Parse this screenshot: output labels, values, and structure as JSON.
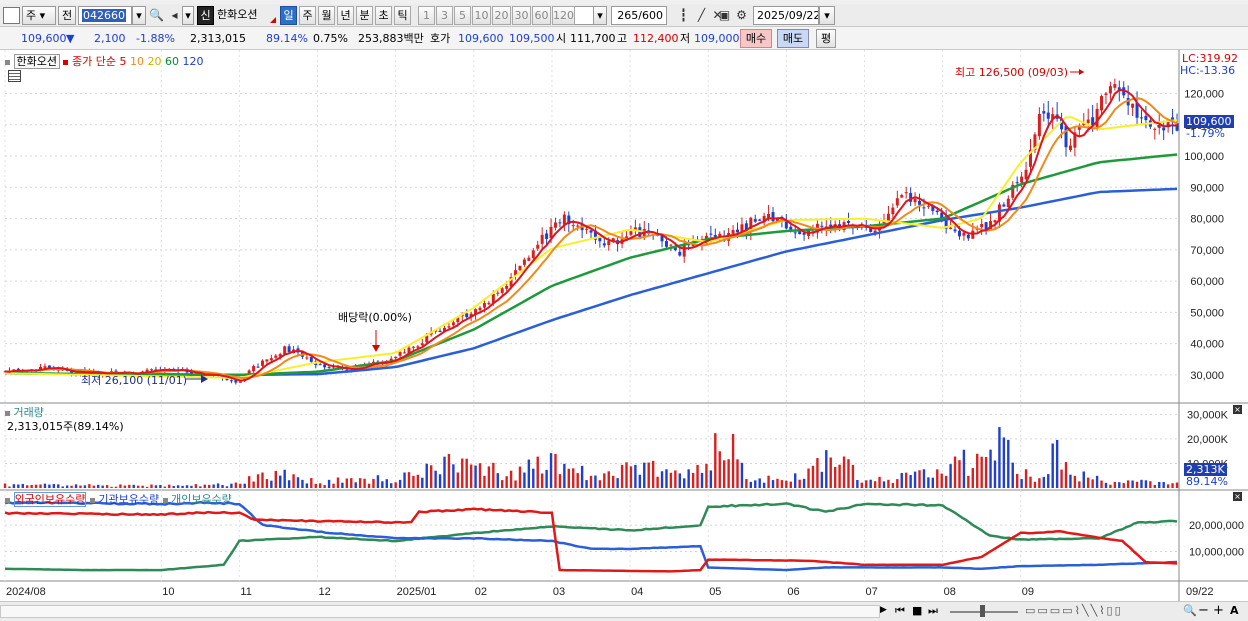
{
  "toolbar1": {
    "type_label": "주",
    "prev_label": "전",
    "code": "042660",
    "stock_badge": "신",
    "stock_name": "한화오션",
    "periods": [
      "일",
      "주",
      "월",
      "년",
      "분",
      "초",
      "틱"
    ],
    "active_period": "일",
    "intervals": [
      "1",
      "3",
      "5",
      "10",
      "20",
      "30",
      "60",
      "120"
    ],
    "count": "265",
    "count_total": "/600",
    "date": "2025/09/22"
  },
  "toolbar2": {
    "price": "109,600",
    "change_arrow": "▼",
    "change": "2,100",
    "change_pct": "-1.88%",
    "volume": "2,313,015",
    "vol_ratio": "89.14%",
    "turnover_pct": "0.75%",
    "amount": "253,883백만",
    "quote_label": "호가",
    "ask": "109,600",
    "bid": "109,500",
    "open_label": "시",
    "open": "111,700",
    "high_label": "고",
    "high": "112,400",
    "low_label": "저",
    "low": "109,000",
    "buy_label": "매수",
    "sell_label": "매도",
    "eval_label": "평"
  },
  "price_legend": {
    "name": "한화오션",
    "series_label": "종가 단순",
    "ma": [
      "5",
      "10",
      "20",
      "60",
      "120"
    ],
    "lc": "LC:319.92",
    "hc": "HC:-13.36"
  },
  "annotations": {
    "high": "최고 126,500 (09/03)",
    "low": "최저 26,100 (11/01)",
    "dividend": "배당락(0.00%)"
  },
  "current_tag": {
    "price": "109,600",
    "pct": "-1.79%"
  },
  "volume_legend": {
    "title": "거래량",
    "value": "2,313,015주(89.14%)",
    "tag": "2,313K",
    "tag_pct": "89.14%"
  },
  "holding_legend": {
    "foreign": "외국인보유수량",
    "institution": "기관보유수량",
    "individual": "개인보유수량"
  },
  "colors": {
    "ma5": "#e0141e",
    "ma10": "#f08a1c",
    "ma20": "#f6f02a",
    "ma60": "#1f9a3a",
    "ma120": "#2a5fd8",
    "up": "#d92020",
    "down": "#1f3fcf"
  },
  "chart_data": [
    {
      "type": "line",
      "name": "price",
      "y_ticks": [
        30000,
        40000,
        50000,
        60000,
        70000,
        80000,
        90000,
        100000,
        110000,
        120000
      ],
      "y_tick_labels": [
        "30,000",
        "40,000",
        "50,000",
        "60,000",
        "70,000",
        "80,000",
        "90,000",
        "100,000",
        "110,000",
        "120,000"
      ],
      "ylim": [
        21000,
        132000
      ],
      "x_labels": [
        "2024/08",
        "10",
        "11",
        "12",
        "2025/01",
        "02",
        "03",
        "04",
        "05",
        "06",
        "07",
        "08",
        "09",
        "09/22"
      ],
      "x_label_months": [
        0,
        2,
        3,
        4,
        5,
        6,
        7,
        8,
        9,
        10,
        11,
        12,
        13,
        13.7
      ],
      "close_path": [
        [
          0,
          31500
        ],
        [
          0.5,
          32000
        ],
        [
          1,
          30500
        ],
        [
          1.5,
          30500
        ],
        [
          2,
          31500
        ],
        [
          2.5,
          30500
        ],
        [
          3,
          28000
        ],
        [
          3.2,
          32500
        ],
        [
          3.6,
          38500
        ],
        [
          4,
          33500
        ],
        [
          4.4,
          31500
        ],
        [
          5,
          35500
        ],
        [
          5.5,
          43500
        ],
        [
          6,
          50500
        ],
        [
          6.4,
          58500
        ],
        [
          6.8,
          71500
        ],
        [
          7.2,
          80500
        ],
        [
          7.6,
          71500
        ],
        [
          8.2,
          76500
        ],
        [
          8.6,
          69500
        ],
        [
          9.2,
          74500
        ],
        [
          9.8,
          81500
        ],
        [
          10.2,
          75500
        ],
        [
          10.6,
          77500
        ],
        [
          11.1,
          76500
        ],
        [
          11.5,
          87500
        ],
        [
          11.9,
          82000
        ],
        [
          12.2,
          73000
        ],
        [
          12.6,
          79000
        ],
        [
          13,
          92000
        ],
        [
          13.3,
          116000
        ],
        [
          13.6,
          104000
        ],
        [
          13.9,
          110500
        ],
        [
          14.15,
          122000
        ],
        [
          14.6,
          111000
        ],
        [
          15,
          109600
        ]
      ],
      "ma120_path": [
        [
          0,
          30500
        ],
        [
          3,
          30000
        ],
        [
          4,
          30200
        ],
        [
          5,
          32500
        ],
        [
          6,
          38500
        ],
        [
          7,
          47500
        ],
        [
          8,
          55500
        ],
        [
          9,
          62500
        ],
        [
          10,
          69500
        ],
        [
          11,
          74500
        ],
        [
          12,
          79500
        ],
        [
          13,
          83500
        ],
        [
          14,
          88500
        ],
        [
          15,
          89500
        ]
      ],
      "ma60_path": [
        [
          0,
          30500
        ],
        [
          3,
          30000
        ],
        [
          4,
          31000
        ],
        [
          5,
          34500
        ],
        [
          6,
          44500
        ],
        [
          7,
          58500
        ],
        [
          8,
          67500
        ],
        [
          9,
          73500
        ],
        [
          10,
          76000
        ],
        [
          11,
          77500
        ],
        [
          12,
          80000
        ],
        [
          13,
          91000
        ],
        [
          14,
          98000
        ],
        [
          15,
          100500
        ]
      ],
      "ma20_path": [
        [
          0,
          30500
        ],
        [
          3,
          29000
        ],
        [
          4,
          34000
        ],
        [
          5,
          37000
        ],
        [
          6,
          51500
        ],
        [
          7,
          70500
        ],
        [
          8,
          76500
        ],
        [
          9,
          72500
        ],
        [
          10,
          79500
        ],
        [
          11,
          80000
        ],
        [
          12,
          77000
        ],
        [
          12.5,
          80000
        ],
        [
          13,
          98000
        ],
        [
          13.6,
          113000
        ],
        [
          14,
          108500
        ],
        [
          15,
          111500
        ]
      ]
    },
    {
      "type": "bar",
      "name": "volume",
      "y_tick_labels": [
        "10,000K",
        "20,000K",
        "30,000K"
      ],
      "y_ticks": [
        10000,
        20000,
        30000
      ],
      "ylim": [
        0,
        33000
      ],
      "unit": "K shares",
      "profile": [
        [
          0,
          1500
        ],
        [
          2,
          1200
        ],
        [
          3,
          1800
        ],
        [
          3.2,
          8000
        ],
        [
          3.6,
          6000
        ],
        [
          4,
          3000
        ],
        [
          5,
          5000
        ],
        [
          5.8,
          14000
        ],
        [
          6,
          10000
        ],
        [
          6.5,
          8000
        ],
        [
          7,
          12000
        ],
        [
          7.5,
          6000
        ],
        [
          8,
          9000
        ],
        [
          9,
          10000
        ],
        [
          9.2,
          32000
        ],
        [
          9.5,
          5000
        ],
        [
          10,
          4000
        ],
        [
          10.6,
          15000
        ],
        [
          11,
          4000
        ],
        [
          12,
          8000
        ],
        [
          12.6,
          18000
        ],
        [
          12.7,
          27000
        ],
        [
          13,
          9000
        ],
        [
          13.2,
          5000
        ],
        [
          13.5,
          22000
        ],
        [
          13.7,
          8000
        ],
        [
          14,
          4000
        ],
        [
          15,
          2300
        ]
      ]
    },
    {
      "type": "line",
      "name": "holdings",
      "y_tick_labels": [
        "10,000,000",
        "20,000,000"
      ],
      "y_ticks": [
        10000000,
        20000000
      ],
      "ylim": [
        0,
        31000000
      ],
      "foreign": [
        [
          0,
          24500000
        ],
        [
          2,
          24000000
        ],
        [
          2.6,
          24800000
        ],
        [
          3.0,
          24500000
        ],
        [
          3.2,
          22000000
        ],
        [
          4,
          21500000
        ],
        [
          5.2,
          21000000
        ],
        [
          5.3,
          25000000
        ],
        [
          6,
          26000000
        ],
        [
          6.8,
          25000000
        ],
        [
          7,
          24500000
        ],
        [
          7.1,
          3000000
        ],
        [
          8.5,
          2500000
        ],
        [
          8.9,
          3000000
        ],
        [
          9,
          7000000
        ],
        [
          10.3,
          6500000
        ],
        [
          11,
          5000000
        ],
        [
          12,
          5000000
        ],
        [
          12.5,
          8000000
        ],
        [
          13,
          17000000
        ],
        [
          13.5,
          17500000
        ],
        [
          14.3,
          14000000
        ],
        [
          14.6,
          6000000
        ],
        [
          15,
          5500000
        ]
      ],
      "institution": [
        [
          0,
          28500000
        ],
        [
          2,
          28000000
        ],
        [
          2.6,
          28500000
        ],
        [
          3.0,
          28000000
        ],
        [
          3.3,
          20000000
        ],
        [
          4,
          17500000
        ],
        [
          5,
          15000000
        ],
        [
          6,
          15000000
        ],
        [
          7,
          14000000
        ],
        [
          7.5,
          11000000
        ],
        [
          8,
          11000000
        ],
        [
          8.9,
          12000000
        ],
        [
          9,
          4000000
        ],
        [
          10,
          3000000
        ],
        [
          10.5,
          4000000
        ],
        [
          12,
          4000000
        ],
        [
          12.5,
          3500000
        ],
        [
          13,
          4500000
        ],
        [
          14,
          5000000
        ],
        [
          15,
          6000000
        ]
      ],
      "individual": [
        [
          0,
          3500000
        ],
        [
          1,
          3000000
        ],
        [
          2,
          3000000
        ],
        [
          2.8,
          5000000
        ],
        [
          3,
          14000000
        ],
        [
          4,
          15500000
        ],
        [
          5,
          14000000
        ],
        [
          6,
          17000000
        ],
        [
          7,
          19500000
        ],
        [
          8,
          18000000
        ],
        [
          8.9,
          20000000
        ],
        [
          9,
          27000000
        ],
        [
          10,
          28000000
        ],
        [
          10.5,
          25000000
        ],
        [
          11,
          28000000
        ],
        [
          12,
          27500000
        ],
        [
          12.6,
          16000000
        ],
        [
          13,
          14500000
        ],
        [
          14,
          15000000
        ],
        [
          14.5,
          21000000
        ],
        [
          15,
          21500000
        ]
      ]
    }
  ]
}
